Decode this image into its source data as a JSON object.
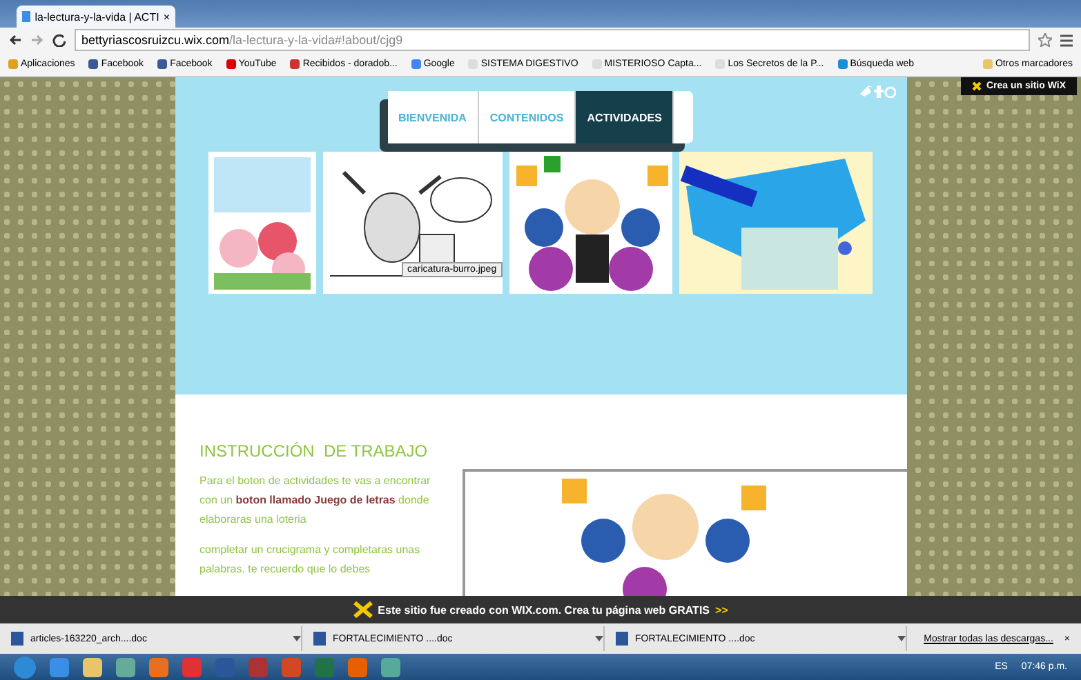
{
  "browser": {
    "tab": {
      "title": "la-lectura-y-la-vida | ACTI",
      "close": "×"
    },
    "url": {
      "host": "bettyriascosruizcu.wix.com",
      "path": "/la-lectura-y-la-vida#!about/cjg9"
    },
    "bookmarks": [
      {
        "label": "Aplicaciones",
        "kind": "apps"
      },
      {
        "label": "Facebook",
        "kind": "facebook"
      },
      {
        "label": "Facebook",
        "kind": "facebook"
      },
      {
        "label": "YouTube",
        "kind": "youtube"
      },
      {
        "label": "Recibidos - doradob...",
        "kind": "gmail"
      },
      {
        "label": "Google",
        "kind": "google"
      },
      {
        "label": "SISTEMA DIGESTIVO",
        "kind": "page"
      },
      {
        "label": "MISTERIOSO Capta...",
        "kind": "page"
      },
      {
        "label": "Los Secretos de la P...",
        "kind": "page"
      },
      {
        "label": "Búsqueda web",
        "kind": "search"
      }
    ],
    "other_bookmarks": "Otros marcadores"
  },
  "site": {
    "wix_badge": "Crea un sitio WiX",
    "nav": [
      {
        "label": "BIENVENIDA",
        "selected": false
      },
      {
        "label": "CONTENIDOS",
        "selected": false
      },
      {
        "label": "ACTIVIDADES",
        "selected": true
      }
    ],
    "tooltip": "caricatura-burro.jpeg",
    "heading": "INSTRUCCIÓN  DE TRABAJO",
    "paragraphs": [
      "Para el boton de actividades te vas a encontrar  con un **boton llamado Juego de letras**  donde elaboraras  una loteria",
      "completar un crucigrama y completaras unas palabras. te recuerdo que lo debes"
    ]
  },
  "wix_banner": {
    "text": "Este sitio fue creado con WIX.com. Crea tu página web GRATIS",
    "arrows": ">>"
  },
  "downloads": {
    "items": [
      "articles-163220_arch....doc",
      "FORTALECIMIENTO ....doc",
      "FORTALECIMIENTO ....doc"
    ],
    "show_all": "Mostrar todas las descargas...",
    "close": "×"
  },
  "taskbar": {
    "apps": [
      {
        "kind": "ie"
      },
      {
        "kind": "folder"
      },
      {
        "kind": "people"
      },
      {
        "kind": "media"
      },
      {
        "kind": "chrome"
      },
      {
        "kind": "word"
      },
      {
        "kind": "access"
      },
      {
        "kind": "powerpoint"
      },
      {
        "kind": "excel"
      },
      {
        "kind": "firefox"
      },
      {
        "kind": "network"
      }
    ],
    "language": "ES",
    "time": "07:46 p.m."
  }
}
